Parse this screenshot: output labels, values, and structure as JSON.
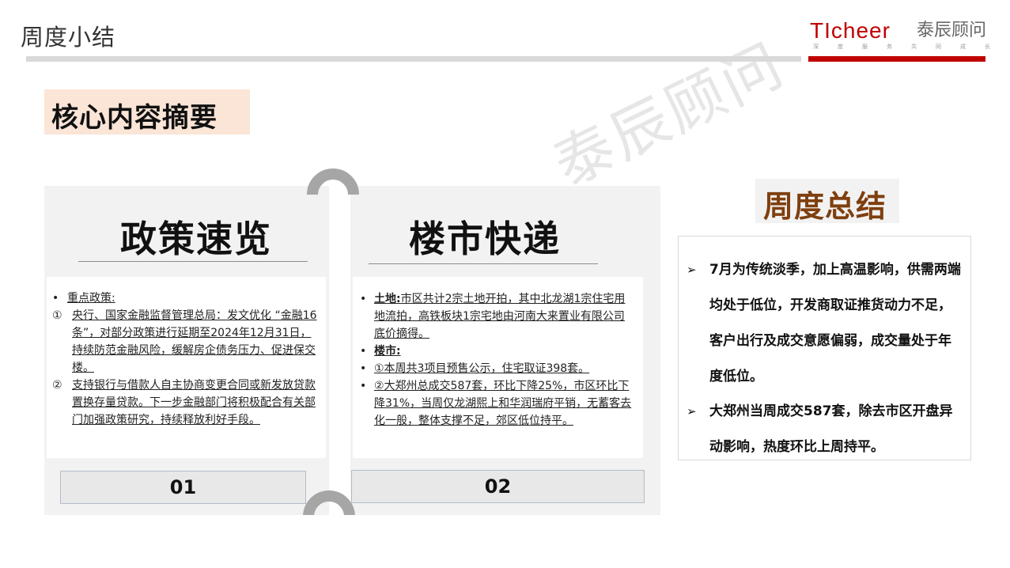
{
  "header": {
    "title": "周度小结",
    "logo_en_a": "TI",
    "logo_en_b": "cheer",
    "logo_cn": "泰辰顾问",
    "logo_sub": [
      "深",
      "度",
      "服",
      "务",
      "共",
      "同",
      "成",
      "长"
    ]
  },
  "core": {
    "label": "核心内容摘要"
  },
  "watermark": "泰辰顾问",
  "policy": {
    "title": "政策速览",
    "bullet_mark": "•",
    "heading": "重点政策:",
    "items": [
      {
        "mark": "①",
        "text": "央行、国家金融监督管理总局：发文优化 “金融16条”，对部分政策进行延期至2024年12月31日，持续防范金融风险，缓解房企债务压力、促进保交楼。"
      },
      {
        "mark": "②",
        "text": "支持银行与借款人自主协商变更合同或新发放贷款置换存量贷款。下一步金融部门将积极配合有关部门加强政策研究，持续释放利好手段。"
      }
    ],
    "number": "01"
  },
  "market": {
    "title": "楼市快递",
    "land_label": "土地:",
    "land_text": "市区共计2宗土地开拍，其中北龙湖1宗住宅用地流拍，高铁板块1宗宅地由河南大来置业有限公司底价摘得。",
    "market_label": "楼市:",
    "market_items": [
      "①本周共3项目预售公示，住宅取证398套。",
      "②大郑州总成交587套，环比下降25%，市区环比下降31%，当周仅龙湖熙上和华润瑞府平销，无蓄客去化一般，整体支撑不足，郊区低位持平。"
    ],
    "number": "02"
  },
  "summary": {
    "tag": "周度总结",
    "arrow": "➢",
    "items": [
      "7月为传统淡季，加上高温影响，供需两端均处于低位，开发商取证推货动力不足，客户出行及成交意愿偏弱，成交量处于年度低位。",
      "大郑州当周成交587套，除去市区开盘异动影响，热度环比上周持平。"
    ]
  }
}
